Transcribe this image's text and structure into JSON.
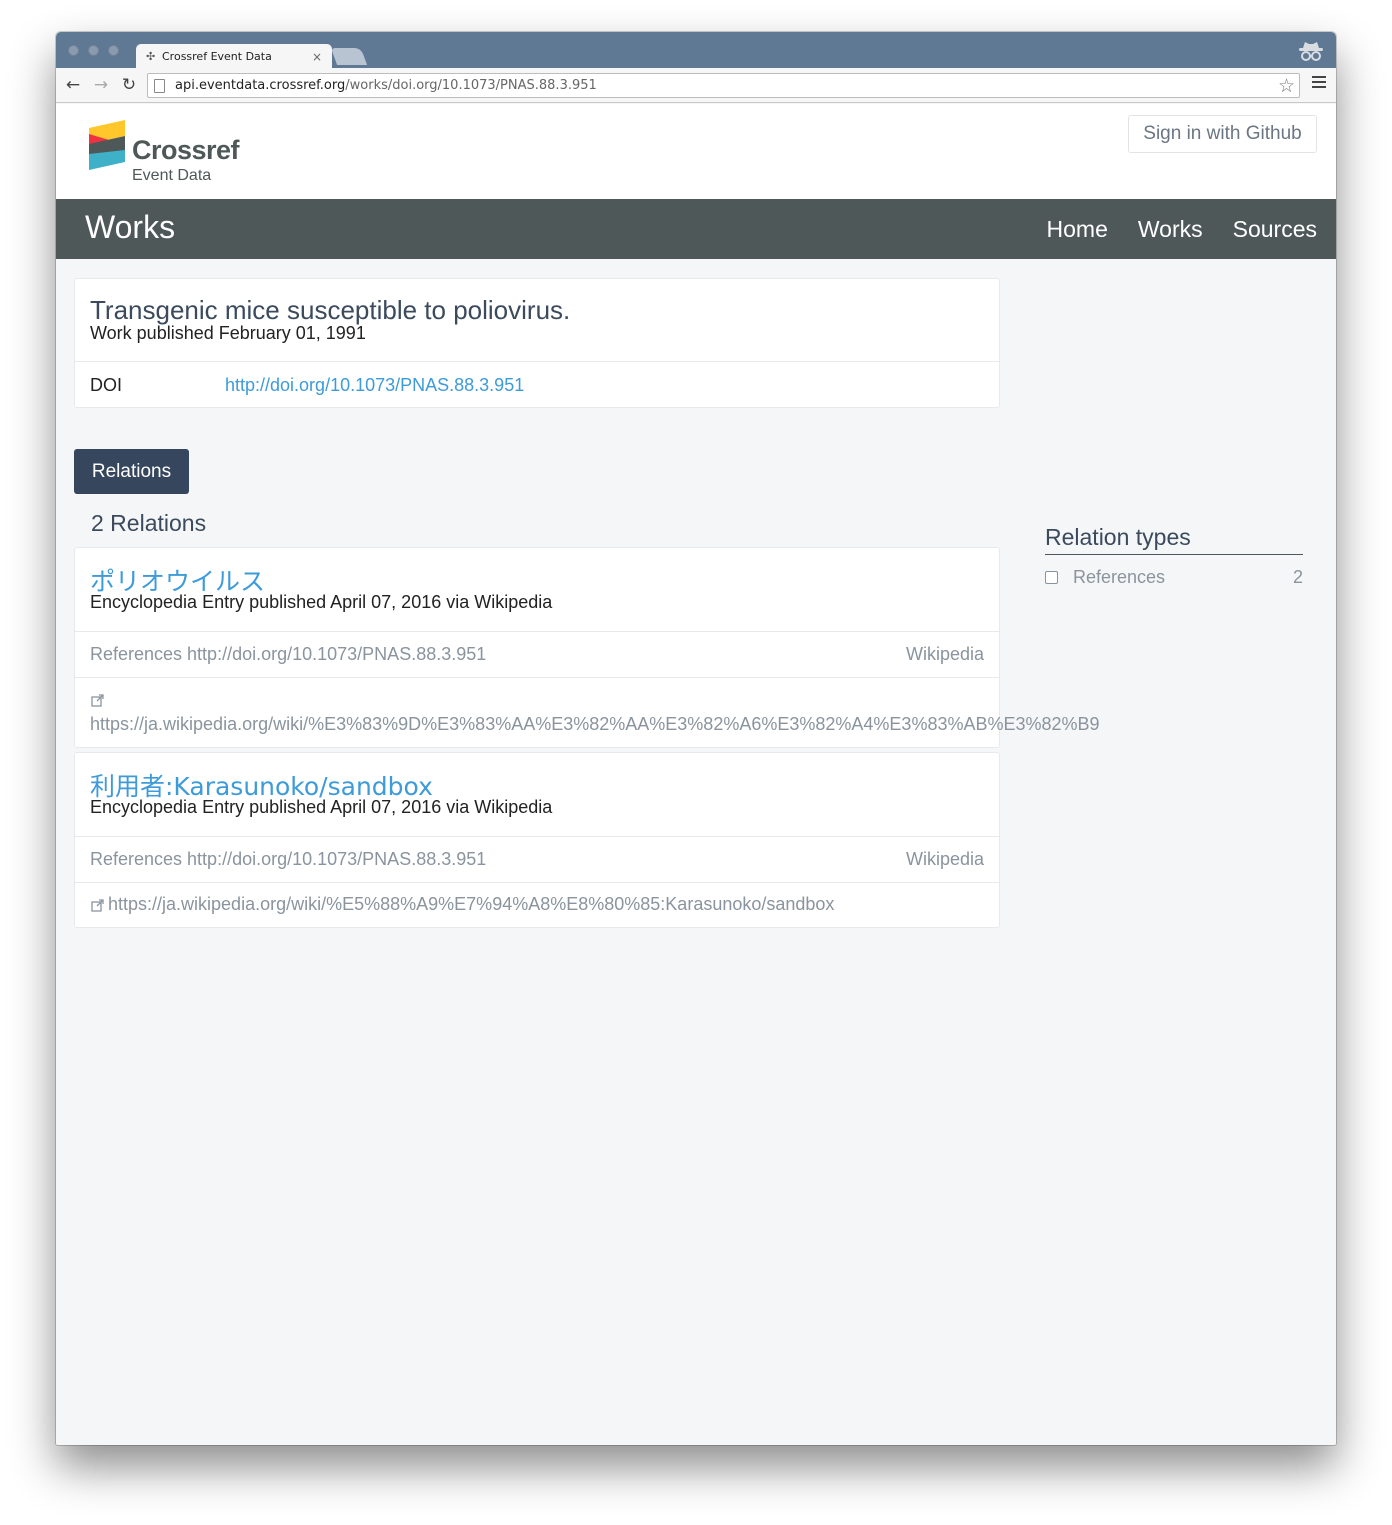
{
  "browser": {
    "tab_title": "Crossref Event Data",
    "tab_close": "×",
    "url_host": "api.eventdata.crossref.org",
    "url_path": "/works/doi.org/10.1073/PNAS.88.3.951"
  },
  "header": {
    "logo_name": "Crossref",
    "logo_sub": "Event Data",
    "signin_label": "Sign in with Github"
  },
  "navbar": {
    "title": "Works",
    "links": [
      "Home",
      "Works",
      "Sources"
    ]
  },
  "work": {
    "title": "Transgenic mice susceptible to poliovirus.",
    "subtitle": "Work published February 01, 1991",
    "doi_label": "DOI",
    "doi_link": "http://doi.org/10.1073/PNAS.88.3.951"
  },
  "relations_tab": "Relations",
  "relations_count": "2 Relations",
  "relations": [
    {
      "title": "ポリオウイルス",
      "subtitle": "Encyclopedia Entry published April 07, 2016 via Wikipedia",
      "relation": "References http://doi.org/10.1073/PNAS.88.3.951",
      "source": "Wikipedia",
      "url": "https://ja.wikipedia.org/wiki/%E3%83%9D%E3%83%AA%E3%82%AA%E3%82%A6%E3%82%A4%E3%83%AB%E3%82%B9"
    },
    {
      "title": "利用者:Karasunoko/sandbox",
      "subtitle": "Encyclopedia Entry published April 07, 2016 via Wikipedia",
      "relation": "References http://doi.org/10.1073/PNAS.88.3.951",
      "source": "Wikipedia",
      "url": "https://ja.wikipedia.org/wiki/%E5%88%A9%E7%94%A8%E8%80%85:Karasunoko/sandbox"
    }
  ],
  "sidebar": {
    "title": "Relation types",
    "facets": [
      {
        "label": "References",
        "count": "2"
      }
    ]
  },
  "colors": {
    "navbar": "#4f5858",
    "link": "#3d9bd9",
    "relations_button": "#35465d",
    "logo_yellow": "#ffc72c",
    "logo_red": "#ef3340",
    "logo_teal": "#3eb1c8",
    "logo_dark": "#4f5858"
  }
}
